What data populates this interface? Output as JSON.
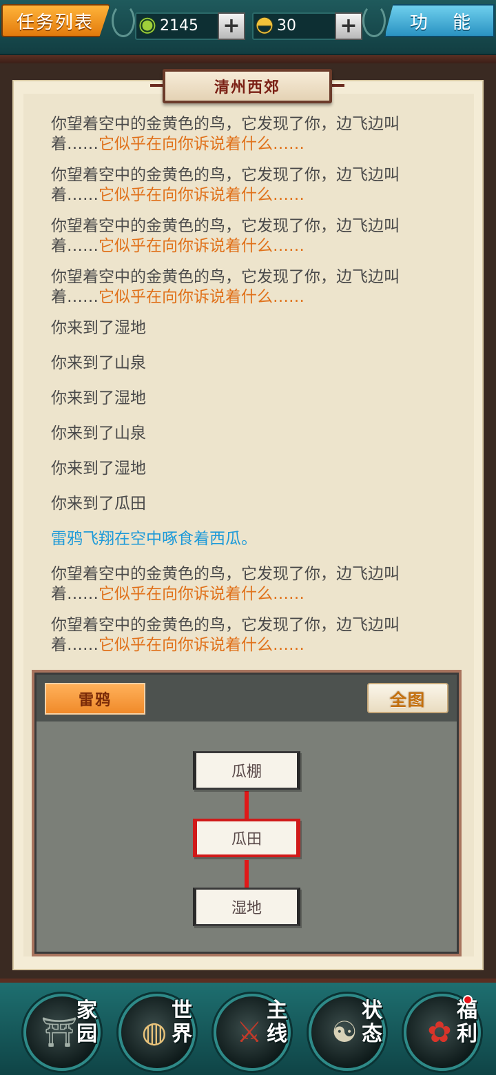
{
  "topbar": {
    "task_list_label": "任务列表",
    "function_label": "功 能",
    "resource_1": {
      "icon": "jade-coin-icon",
      "value": "2145",
      "add_label": "+"
    },
    "resource_2": {
      "icon": "gold-ingot-icon",
      "value": "30",
      "add_label": "+"
    }
  },
  "location": {
    "title": "清州西郊"
  },
  "log": {
    "entries": [
      {
        "text": "你望着空中的金黄色的鸟，它发现了你，边飞边叫着……",
        "highlight": "它似乎在向你诉说着什么……"
      },
      {
        "text": "你望着空中的金黄色的鸟，它发现了你，边飞边叫着……",
        "highlight": "它似乎在向你诉说着什么……"
      },
      {
        "text": "你望着空中的金黄色的鸟，它发现了你，边飞边叫着……",
        "highlight": "它似乎在向你诉说着什么……"
      },
      {
        "text": "你望着空中的金黄色的鸟，它发现了你，边飞边叫着……",
        "highlight": "它似乎在向你诉说着什么……"
      },
      {
        "text": "你来到了湿地"
      },
      {
        "text": "你来到了山泉"
      },
      {
        "text": "你来到了湿地"
      },
      {
        "text": "你来到了山泉"
      },
      {
        "text": "你来到了湿地"
      },
      {
        "text": "你来到了瓜田"
      },
      {
        "text": "雷鸦飞翔在空中啄食着西瓜。"
      },
      {
        "text": "你望着空中的金黄色的鸟，它发现了你，边飞边叫着……",
        "highlight": "它似乎在向你诉说着什么……"
      },
      {
        "text": "你望着空中的金黄色的鸟，它发现了你，边飞边叫着……",
        "highlight": "它似乎在向你诉说着什么……"
      }
    ]
  },
  "map": {
    "npc_label": "雷鸦",
    "full_map_label": "全图",
    "nodes": [
      {
        "name": "瓜棚",
        "current": false
      },
      {
        "name": "瓜田",
        "current": true
      },
      {
        "name": "湿地",
        "current": false
      }
    ]
  },
  "bottom_nav": [
    {
      "label": "家园",
      "icon": "home-icon"
    },
    {
      "label": "世界",
      "icon": "world-icon"
    },
    {
      "label": "主线",
      "icon": "main-quest-icon"
    },
    {
      "label": "状态",
      "icon": "status-icon"
    },
    {
      "label": "福利",
      "icon": "welfare-icon",
      "badge": true
    }
  ],
  "colors": {
    "log_text": "#4a4a4a",
    "highlight_orange": "#e0711a",
    "event_blue": "#1e9ad8",
    "current_node_border": "#d01a1a",
    "teal_bar": "#1e6f70"
  }
}
